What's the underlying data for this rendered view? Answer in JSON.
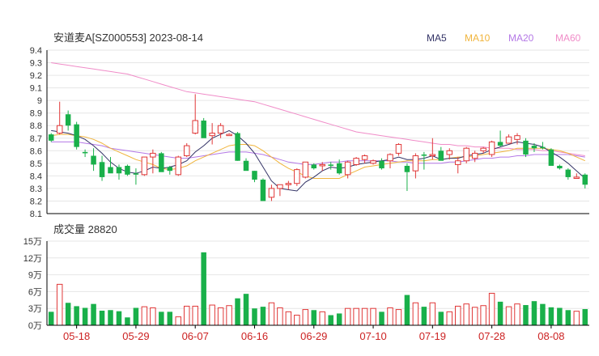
{
  "title": "安道麦A[SZ000553] 2023-08-14",
  "volume_title": "成交量 28820",
  "legend": [
    {
      "name": "MA5",
      "color": "#333366"
    },
    {
      "name": "MA10",
      "color": "#f0b43c"
    },
    {
      "name": "MA20",
      "color": "#b478e6"
    },
    {
      "name": "MA60",
      "color": "#f08cc8"
    }
  ],
  "colors": {
    "up": "#e03838",
    "down": "#19b04a",
    "grid": "#e6e6e6",
    "axis": "#000000"
  },
  "chart_data": [
    {
      "type": "candlestick",
      "title": "安道麦A[SZ000553] 2023-08-14",
      "ylim": [
        8.1,
        9.4
      ],
      "y_ticks": [
        "9.4",
        "9.3",
        "9.2",
        "9.1",
        "9",
        "8.9",
        "8.8",
        "8.7",
        "8.6",
        "8.5",
        "8.4",
        "8.3",
        "8.2",
        "8.1"
      ],
      "x_tick_labels": [
        "05-18",
        "05-29",
        "06-07",
        "06-16",
        "06-29",
        "07-10",
        "07-19",
        "07-28",
        "08-08"
      ],
      "dates": [
        "05-15",
        "05-16",
        "05-17",
        "05-18",
        "05-19",
        "05-22",
        "05-23",
        "05-24",
        "05-25",
        "05-26",
        "05-29",
        "05-30",
        "05-31",
        "06-01",
        "06-02",
        "06-05",
        "06-06",
        "06-07",
        "06-08",
        "06-09",
        "06-12",
        "06-13",
        "06-14",
        "06-15",
        "06-16",
        "06-19",
        "06-20",
        "06-21",
        "06-26",
        "06-27",
        "06-28",
        "06-29",
        "06-30",
        "07-03",
        "07-04",
        "07-05",
        "07-06",
        "07-07",
        "07-10",
        "07-11",
        "07-12",
        "07-13",
        "07-14",
        "07-17",
        "07-18",
        "07-19",
        "07-20",
        "07-21",
        "07-24",
        "07-25",
        "07-26",
        "07-27",
        "07-28",
        "07-31",
        "08-01",
        "08-02",
        "08-03",
        "08-04",
        "08-07",
        "08-08",
        "08-09",
        "08-10",
        "08-11",
        "08-14"
      ],
      "ohlc": [
        [
          8.73,
          8.74,
          8.67,
          8.68
        ],
        [
          8.74,
          8.99,
          8.73,
          8.8
        ],
        [
          8.89,
          8.92,
          8.76,
          8.8
        ],
        [
          8.81,
          8.83,
          8.61,
          8.63
        ],
        [
          8.59,
          8.61,
          8.55,
          8.58
        ],
        [
          8.56,
          8.62,
          8.44,
          8.49
        ],
        [
          8.51,
          8.56,
          8.36,
          8.39
        ],
        [
          8.47,
          8.55,
          8.43,
          8.42
        ],
        [
          8.47,
          8.49,
          8.37,
          8.42
        ],
        [
          8.48,
          8.49,
          8.4,
          8.41
        ],
        [
          8.42,
          8.46,
          8.33,
          8.41
        ],
        [
          8.41,
          8.55,
          8.4,
          8.55
        ],
        [
          8.55,
          8.61,
          8.42,
          8.58
        ],
        [
          8.58,
          8.59,
          8.46,
          8.43
        ],
        [
          8.47,
          8.48,
          8.41,
          8.44
        ],
        [
          8.41,
          8.56,
          8.4,
          8.55
        ],
        [
          8.56,
          8.66,
          8.55,
          8.64
        ],
        [
          8.74,
          9.05,
          8.73,
          8.84
        ],
        [
          8.84,
          8.86,
          8.71,
          8.7
        ],
        [
          8.72,
          8.82,
          8.65,
          8.74
        ],
        [
          8.74,
          8.82,
          8.7,
          8.8
        ],
        [
          8.72,
          8.74,
          8.72,
          8.73
        ],
        [
          8.74,
          8.75,
          8.52,
          8.52
        ],
        [
          8.52,
          8.54,
          8.45,
          8.44
        ],
        [
          8.44,
          8.44,
          8.35,
          8.37
        ],
        [
          8.37,
          8.38,
          8.2,
          8.2
        ],
        [
          8.23,
          8.33,
          8.2,
          8.3
        ],
        [
          8.3,
          8.32,
          8.24,
          8.33
        ],
        [
          8.33,
          8.36,
          8.29,
          8.34
        ],
        [
          8.34,
          8.46,
          8.32,
          8.45
        ],
        [
          8.39,
          8.51,
          8.38,
          8.51
        ],
        [
          8.49,
          8.5,
          8.45,
          8.46
        ],
        [
          8.48,
          8.51,
          8.44,
          8.49
        ],
        [
          8.49,
          8.51,
          8.45,
          8.48
        ],
        [
          8.5,
          8.53,
          8.41,
          8.42
        ],
        [
          8.41,
          8.52,
          8.38,
          8.51
        ],
        [
          8.49,
          8.55,
          8.48,
          8.54
        ],
        [
          8.53,
          8.57,
          8.5,
          8.56
        ],
        [
          8.5,
          8.53,
          8.49,
          8.52
        ],
        [
          8.52,
          8.54,
          8.45,
          8.46
        ],
        [
          8.52,
          8.58,
          8.46,
          8.57
        ],
        [
          8.58,
          8.66,
          8.56,
          8.65
        ],
        [
          8.48,
          8.5,
          8.28,
          8.43
        ],
        [
          8.44,
          8.58,
          8.38,
          8.56
        ],
        [
          8.57,
          8.59,
          8.45,
          8.56
        ],
        [
          8.56,
          8.7,
          8.53,
          8.57
        ],
        [
          8.6,
          8.63,
          8.53,
          8.52
        ],
        [
          8.57,
          8.62,
          8.53,
          8.6
        ],
        [
          8.49,
          8.55,
          8.42,
          8.52
        ],
        [
          8.52,
          8.63,
          8.5,
          8.62
        ],
        [
          8.54,
          8.6,
          8.51,
          8.58
        ],
        [
          8.6,
          8.63,
          8.58,
          8.62
        ],
        [
          8.57,
          8.68,
          8.55,
          8.67
        ],
        [
          8.67,
          8.76,
          8.63,
          8.64
        ],
        [
          8.66,
          8.73,
          8.66,
          8.71
        ],
        [
          8.69,
          8.74,
          8.65,
          8.72
        ],
        [
          8.68,
          8.7,
          8.55,
          8.57
        ],
        [
          8.64,
          8.66,
          8.59,
          8.62
        ],
        [
          8.63,
          8.67,
          8.61,
          8.62
        ],
        [
          8.61,
          8.62,
          8.49,
          8.48
        ],
        [
          8.48,
          8.49,
          8.45,
          8.46
        ],
        [
          8.45,
          8.46,
          8.37,
          8.39
        ],
        [
          8.38,
          8.42,
          8.38,
          8.39
        ],
        [
          8.41,
          8.42,
          8.3,
          8.33
        ]
      ],
      "ma5": [
        8.76,
        8.75,
        8.74,
        8.72,
        8.69,
        8.64,
        8.58,
        8.51,
        8.46,
        8.43,
        8.42,
        8.44,
        8.47,
        8.46,
        8.47,
        8.49,
        8.52,
        8.59,
        8.64,
        8.7,
        8.73,
        8.76,
        8.72,
        8.66,
        8.58,
        8.47,
        8.36,
        8.3,
        8.29,
        8.28,
        8.35,
        8.39,
        8.44,
        8.47,
        8.46,
        8.47,
        8.49,
        8.5,
        8.51,
        8.52,
        8.53,
        8.55,
        8.53,
        8.53,
        8.54,
        8.56,
        8.53,
        8.54,
        8.54,
        8.56,
        8.57,
        8.58,
        8.61,
        8.63,
        8.65,
        8.67,
        8.66,
        8.65,
        8.63,
        8.59,
        8.55,
        8.5,
        8.44,
        8.38
      ],
      "ma10": [
        8.72,
        8.73,
        8.73,
        8.72,
        8.71,
        8.69,
        8.66,
        8.62,
        8.59,
        8.56,
        8.53,
        8.51,
        8.49,
        8.46,
        8.45,
        8.46,
        8.48,
        8.52,
        8.55,
        8.58,
        8.61,
        8.64,
        8.65,
        8.65,
        8.64,
        8.6,
        8.55,
        8.5,
        8.46,
        8.43,
        8.4,
        8.38,
        8.38,
        8.38,
        8.38,
        8.41,
        8.44,
        8.47,
        8.48,
        8.49,
        8.5,
        8.51,
        8.52,
        8.52,
        8.52,
        8.53,
        8.53,
        8.54,
        8.55,
        8.55,
        8.56,
        8.57,
        8.58,
        8.59,
        8.6,
        8.62,
        8.62,
        8.62,
        8.62,
        8.61,
        8.6,
        8.58,
        8.55,
        8.52
      ],
      "ma20": [
        8.67,
        8.67,
        8.67,
        8.67,
        8.66,
        8.65,
        8.64,
        8.62,
        8.61,
        8.6,
        8.59,
        8.58,
        8.57,
        8.56,
        8.55,
        8.54,
        8.54,
        8.55,
        8.56,
        8.57,
        8.58,
        8.59,
        8.59,
        8.59,
        8.58,
        8.57,
        8.55,
        8.53,
        8.51,
        8.5,
        8.49,
        8.49,
        8.5,
        8.51,
        8.51,
        8.52,
        8.52,
        8.52,
        8.52,
        8.52,
        8.52,
        8.51,
        8.51,
        8.5,
        8.5,
        8.5,
        8.5,
        8.51,
        8.51,
        8.52,
        8.53,
        8.54,
        8.54,
        8.55,
        8.55,
        8.56,
        8.56,
        8.57,
        8.57,
        8.57,
        8.57,
        8.57,
        8.56,
        8.55
      ],
      "ma60": [
        9.3,
        9.29,
        9.28,
        9.27,
        9.26,
        9.25,
        9.24,
        9.23,
        9.22,
        9.21,
        9.19,
        9.17,
        9.15,
        9.13,
        9.11,
        9.09,
        9.07,
        9.06,
        9.05,
        9.04,
        9.03,
        9.02,
        9.01,
        9.0,
        8.99,
        8.97,
        8.95,
        8.93,
        8.91,
        8.89,
        8.87,
        8.85,
        8.83,
        8.81,
        8.79,
        8.77,
        8.75,
        8.74,
        8.73,
        8.72,
        8.71,
        8.7,
        8.69,
        8.68,
        8.67,
        8.66,
        8.65,
        8.65,
        8.64,
        8.64,
        8.63,
        8.63,
        8.62,
        8.62,
        8.62,
        8.61,
        8.61,
        8.61,
        8.6,
        8.6,
        8.59,
        8.58,
        8.57,
        8.56
      ]
    },
    {
      "type": "bar",
      "title": "成交量 28820",
      "ylim": [
        0,
        150000
      ],
      "y_ticks": [
        "15万",
        "12万",
        "9万",
        "6万",
        "3万",
        "0万"
      ],
      "values": [
        24000,
        73000,
        40000,
        34000,
        31000,
        38000,
        26000,
        27000,
        25000,
        14000,
        31000,
        33000,
        31000,
        24000,
        24000,
        15000,
        34000,
        34000,
        130000,
        36000,
        31000,
        35000,
        48000,
        56000,
        30000,
        33000,
        40000,
        31000,
        24000,
        18000,
        28000,
        27000,
        24000,
        18000,
        21000,
        30000,
        30000,
        30000,
        30000,
        24000,
        31000,
        28000,
        54000,
        40000,
        33000,
        40000,
        24000,
        24000,
        34000,
        38000,
        32000,
        35000,
        57000,
        42000,
        33000,
        38000,
        36000,
        43000,
        38000,
        32000,
        31000,
        27000,
        25000,
        28820
      ]
    }
  ]
}
